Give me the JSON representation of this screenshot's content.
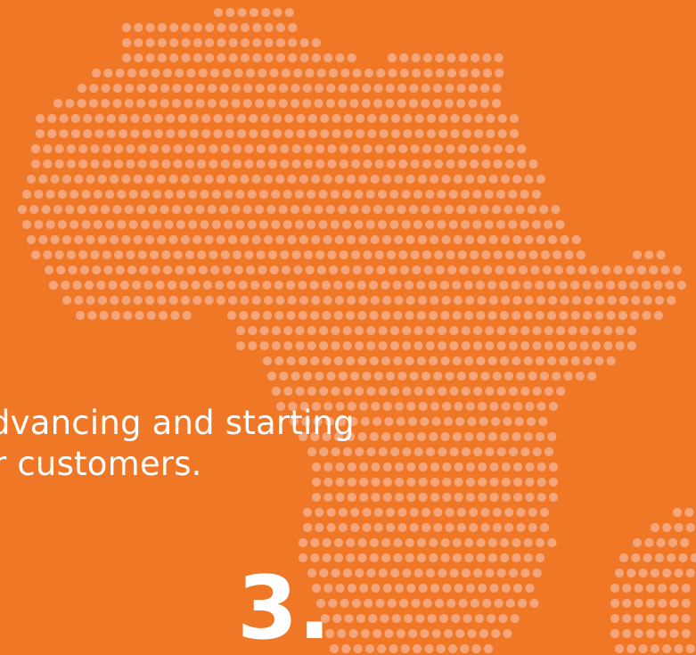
{
  "slide": {
    "text_lines": [
      "dvancing and starting",
      "r customers."
    ],
    "step_number": "3."
  },
  "colors": {
    "background": "#F07726",
    "dots": "#F4A67A",
    "text": "#FFFFFF"
  },
  "decoration": {
    "map_icon": "africa-dotted-map-icon"
  }
}
